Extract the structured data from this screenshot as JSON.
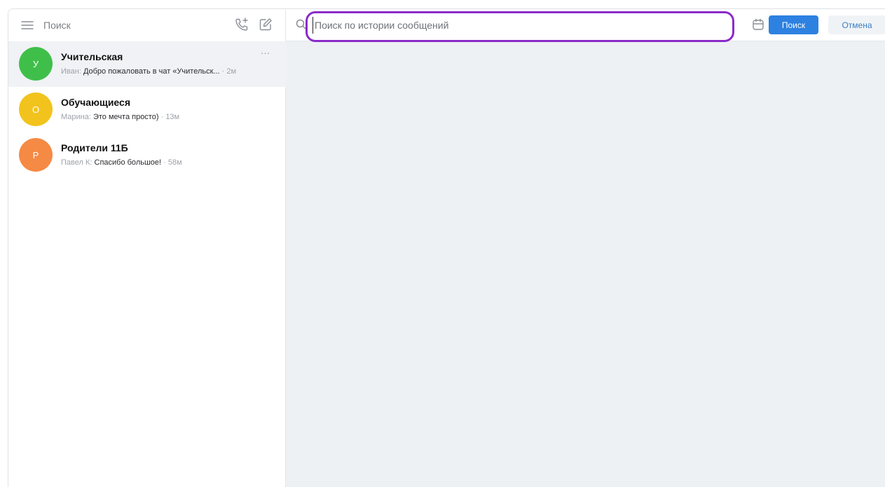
{
  "sidebar": {
    "search_placeholder": "Поиск",
    "chats": [
      {
        "avatar_letter": "У",
        "avatar_color": "#3fbf4a",
        "title": "Учительская",
        "sender": "Иван:",
        "message": "Добро пожаловать в чат «Учительск...",
        "separator": "·",
        "time": "2м",
        "more": "···",
        "active": true
      },
      {
        "avatar_letter": "О",
        "avatar_color": "#f2c31c",
        "title": "Обучающиеся",
        "sender": "Марина:",
        "message": "Это мечта просто)",
        "separator": "·",
        "time": "13м",
        "active": false
      },
      {
        "avatar_letter": "Р",
        "avatar_color": "#f58a45",
        "title": "Родители 11Б",
        "sender": "Павел К:",
        "message": "Спасибо большое!",
        "separator": "·",
        "time": "58м",
        "active": false
      }
    ]
  },
  "main": {
    "history_search_placeholder": "Поиск по истории сообщений",
    "search_button": "Поиск",
    "cancel_button": "Отмена",
    "highlight_color": "#8a2bc8",
    "background_color": "#eef1f4"
  }
}
